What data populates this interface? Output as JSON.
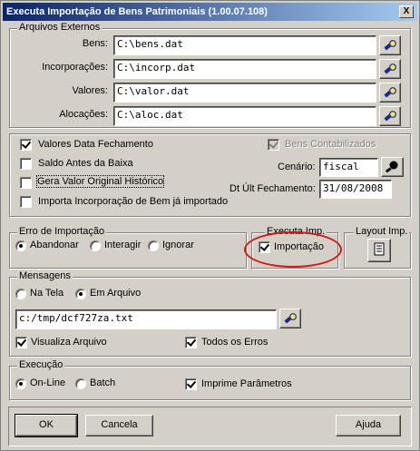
{
  "window": {
    "title": "Executa Importação de Bens Patrimoniais (1.00.07.108)",
    "close_label": "X"
  },
  "arquivos": {
    "group_label": "Arquivos Externos",
    "rows": [
      {
        "label": "Bens:",
        "value": "C:\\bens.dat"
      },
      {
        "label": "Incorporações:",
        "value": "C:\\incorp.dat"
      },
      {
        "label": "Valores:",
        "value": "C:\\valor.dat"
      },
      {
        "label": "Alocações:",
        "value": "C:\\aloc.dat"
      }
    ]
  },
  "opcoes": {
    "valores_data_fechamento": "Valores Data Fechamento",
    "saldo_antes_baixa": "Saldo Antes da Baixa",
    "gera_valor_original": "Gera Valor Original Histórico",
    "importa_incorporacao": "Importa Incorporação de Bem já importado",
    "bens_contabilizados": "Bens Contabilizados",
    "cenario_label": "Cenário:",
    "cenario_value": "fiscal",
    "dt_fechamento_label": "Dt Últ Fechamento:",
    "dt_fechamento_value": "31/08/2008"
  },
  "erro": {
    "group_label": "Erro de Importação",
    "options": [
      "Abandonar",
      "Interagir",
      "Ignorar"
    ]
  },
  "executa": {
    "group_label": "Executa Imp.",
    "importacao": "Importação"
  },
  "layout": {
    "group_label": "Layout Imp."
  },
  "mensagens": {
    "group_label": "Mensagens",
    "na_tela": "Na Tela",
    "em_arquivo": "Em Arquivo",
    "file_value": "c:/tmp/dcf727za.txt",
    "visualiza": "Visualiza Arquivo",
    "todos_erros": "Todos os Erros"
  },
  "execucao": {
    "group_label": "Execução",
    "online": "On-Line",
    "batch": "Batch",
    "imprime": "Imprime Parâmetros"
  },
  "buttons": {
    "ok": "OK",
    "cancela": "Cancela",
    "ajuda": "Ajuda"
  },
  "colors": {
    "highlight_ellipse": "#d01818",
    "title_start": "#0a246a"
  },
  "icons": {
    "browse": "flashlight-icon",
    "search": "magnifier-icon",
    "layout": "document-icon"
  }
}
